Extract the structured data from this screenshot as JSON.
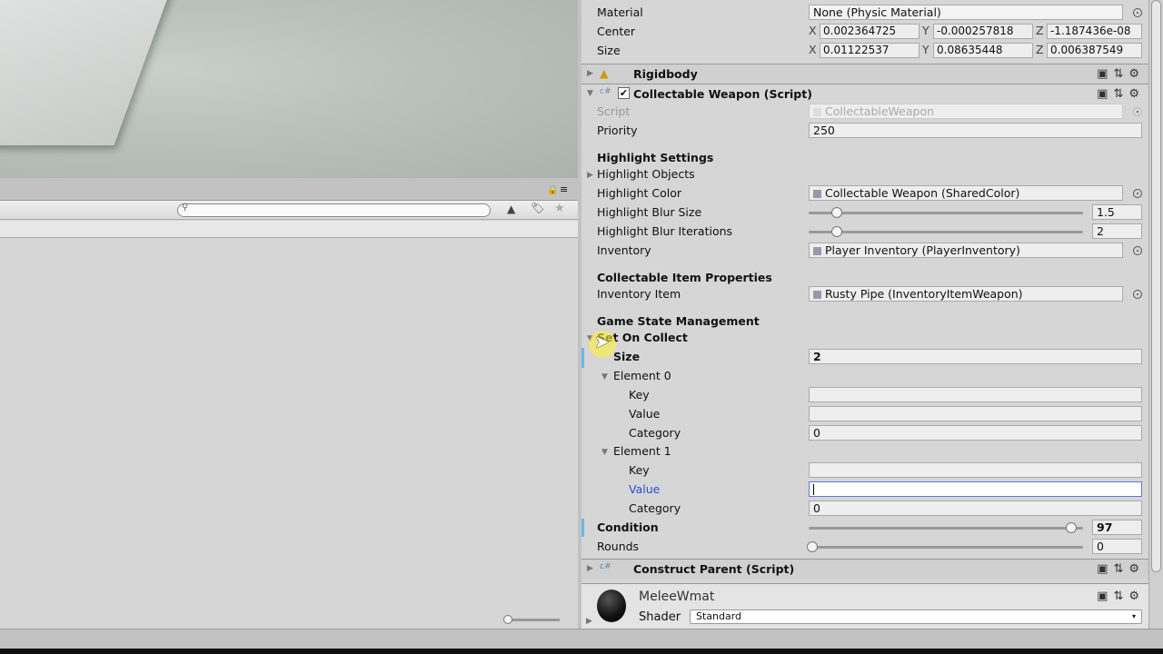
{
  "inspector": {
    "collider": {
      "material_label": "Material",
      "material_value": "None (Physic Material)",
      "center_label": "Center",
      "center": {
        "x": "0.002364725",
        "y": "-0.000257818",
        "z": "-1.187436e-08"
      },
      "size_label": "Size",
      "size": {
        "x": "0.01122537",
        "y": "0.08635448",
        "z": "0.006387549"
      }
    },
    "rigidbody": {
      "title": "Rigidbody"
    },
    "collectable": {
      "title": "Collectable Weapon (Script)",
      "enabled": true,
      "script_label": "Script",
      "script_value": "CollectableWeapon",
      "priority_label": "Priority",
      "priority_value": "250",
      "highlight_header": "Highlight Settings",
      "highlight_objects": "Highlight Objects",
      "highlight_color_label": "Highlight Color",
      "highlight_color_value": "Collectable Weapon (SharedColor)",
      "blur_size_label": "Highlight Blur Size",
      "blur_size_value": "1.5",
      "blur_size_fraction": 0.1,
      "blur_iter_label": "Highlight Blur Iterations",
      "blur_iter_value": "2",
      "blur_iter_fraction": 0.1,
      "inventory_label": "Inventory",
      "inventory_value": "Player Inventory (PlayerInventory)",
      "item_header": "Collectable Item Properties",
      "inventory_item_label": "Inventory Item",
      "inventory_item_value": "Rusty Pipe (InventoryItemWeapon)",
      "gsm_header": "Game State Management",
      "set_on_collect": "Set On Collect",
      "size_label": "Size",
      "size_value": "2",
      "elements": [
        {
          "label": "Element 0",
          "key_label": "Key",
          "key_value": "",
          "value_label": "Value",
          "value_value": "",
          "category_label": "Category",
          "category_value": "0"
        },
        {
          "label": "Element 1",
          "key_label": "Key",
          "key_value": "",
          "value_label": "Value",
          "value_value": "",
          "category_label": "Category",
          "category_value": "0"
        }
      ],
      "condition_label": "Condition",
      "condition_value": "97",
      "condition_fraction": 0.97,
      "rounds_label": "Rounds",
      "rounds_value": "0",
      "rounds_fraction": 0.0
    },
    "construct": {
      "title": "Construct Parent (Script)"
    },
    "material": {
      "name": "MeleeWmat",
      "shader_label": "Shader",
      "shader_value": "Standard"
    }
  },
  "icons": {
    "help": "book-help-icon",
    "preset": "sliders-icon",
    "gear": "gear-icon",
    "lock": "lock-icon",
    "search": "search-icon"
  },
  "colors": {
    "active_label": "#2a4fd0",
    "focus_border": "#5b7bd8"
  }
}
